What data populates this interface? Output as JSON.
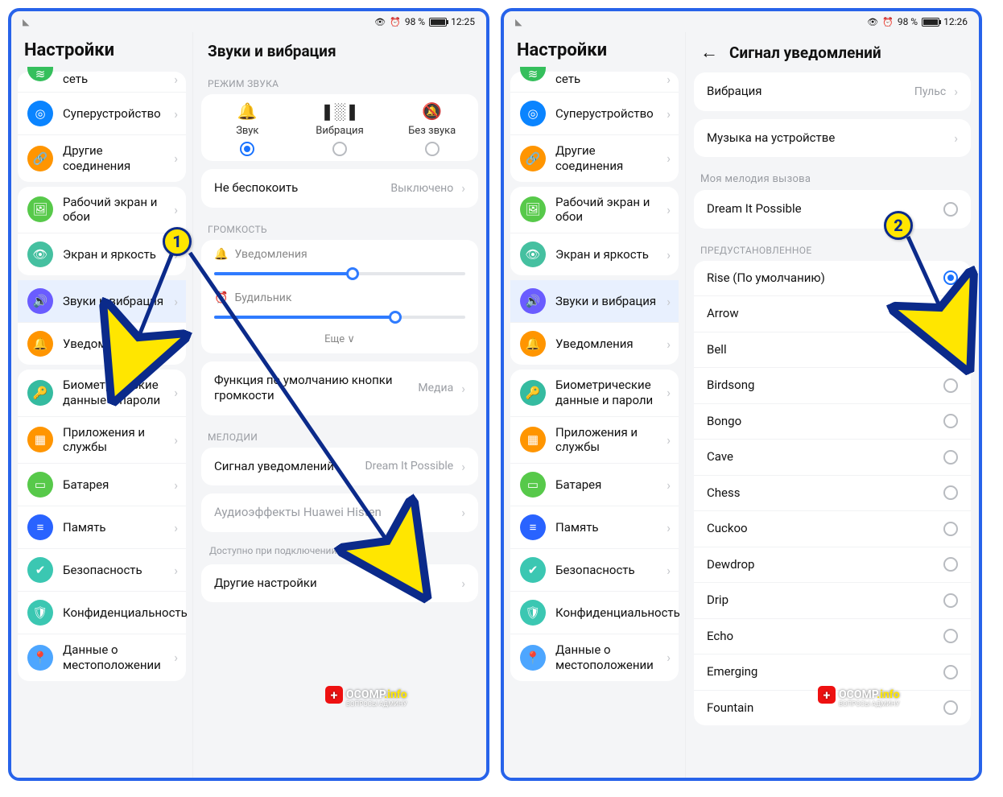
{
  "status": {
    "battery": "98 %",
    "t1": "12:25",
    "t2": "12:26"
  },
  "side_title": "Настройки",
  "sidebar": [
    {
      "label": "сеть",
      "color": "c-green",
      "glyph": "≋",
      "cut": true,
      "chev": true
    },
    {
      "label": "Суперустройство",
      "color": "c-deep",
      "glyph": "◎",
      "chev": true
    },
    {
      "label": "Другие соединения",
      "color": "c-orange",
      "glyph": "🔗",
      "chev": true
    },
    {
      "_break": true
    },
    {
      "label": "Рабочий экран и обои",
      "color": "c-lime",
      "glyph": "🖼",
      "chev": true
    },
    {
      "label": "Экран и яркость",
      "color": "c-teal",
      "glyph": "👁",
      "chev": true
    },
    {
      "_break": true
    },
    {
      "label": "Звуки и вибрация",
      "color": "c-purple",
      "glyph": "🔊",
      "chev": true,
      "selected": true
    },
    {
      "label": "Уведомления",
      "color": "c-orange",
      "glyph": "🔔",
      "chev": true
    },
    {
      "_break": true
    },
    {
      "label": "Биометрические данные и пароли",
      "color": "c-aqua",
      "glyph": "🔑",
      "chev": true
    },
    {
      "label": "Приложения и службы",
      "color": "c-orange",
      "glyph": "▦",
      "chev": true
    },
    {
      "label": "Батарея",
      "color": "c-lime",
      "glyph": "▭",
      "chev": true
    },
    {
      "label": "Память",
      "color": "c-navy",
      "glyph": "≡",
      "chev": true
    },
    {
      "label": "Безопасность",
      "color": "c-mint",
      "glyph": "✔",
      "chev": true
    },
    {
      "label": "Конфиденциальность",
      "color": "c-mint",
      "glyph": "🛡",
      "chev": true
    },
    {
      "label": "Данные о местоположении",
      "color": "c-sky",
      "glyph": "📍",
      "chev": true
    }
  ],
  "left": {
    "title": "Звуки и вибрация",
    "sound_mode_label": "РЕЖИМ ЗВУКА",
    "modes": [
      {
        "label": "Звук",
        "glyph": "🔔",
        "on": true
      },
      {
        "label": "Вибрация",
        "glyph": "❚░❚",
        "on": false
      },
      {
        "label": "Без звука",
        "glyph": "🔕",
        "on": false
      }
    ],
    "dnd": {
      "k": "Не беспокоить",
      "v": "Выключено"
    },
    "vol_label": "ГРОМКОСТЬ",
    "sliders": [
      {
        "label": "Уведомления",
        "glyph": "🔔",
        "pct": 55
      },
      {
        "label": "Будильник",
        "glyph": "⏰",
        "pct": 72
      }
    ],
    "more": "Еще ∨",
    "vol_fn": {
      "k": "Функция по умолчанию кнопки громкости",
      "v": "Медиа"
    },
    "melody_label": "МЕЛОДИИ",
    "notif_signal": {
      "k": "Сигнал уведомлений",
      "v": "Dream It Possible"
    },
    "histen": "Аудиоэффекты Huawei Histen",
    "histen_hint": "Доступно при подключении наушников",
    "other": "Другие настройки"
  },
  "right": {
    "title": "Сигнал уведомлений",
    "vibration": {
      "k": "Вибрация",
      "v": "Пульс"
    },
    "music": "Музыка на устройстве",
    "my_ring": "Моя мелодия вызова",
    "dream": "Dream It Possible",
    "preset": "ПРЕДУСТАНОВЛЕННОЕ",
    "items": [
      {
        "label": "Rise (По умолчанию)",
        "on": true
      },
      {
        "label": "Arrow"
      },
      {
        "label": "Bell"
      },
      {
        "label": "Birdsong"
      },
      {
        "label": "Bongo"
      },
      {
        "label": "Cave"
      },
      {
        "label": "Chess"
      },
      {
        "label": "Cuckoo"
      },
      {
        "label": "Dewdrop"
      },
      {
        "label": "Drip"
      },
      {
        "label": "Echo"
      },
      {
        "label": "Emerging"
      },
      {
        "label": "Fountain"
      }
    ]
  },
  "markers": {
    "m1": "1",
    "m2": "2"
  },
  "watermark": {
    "t1": "OCOMP",
    "t2": ".info",
    "sub": "ВОПРОСЫ АДМИНУ"
  }
}
